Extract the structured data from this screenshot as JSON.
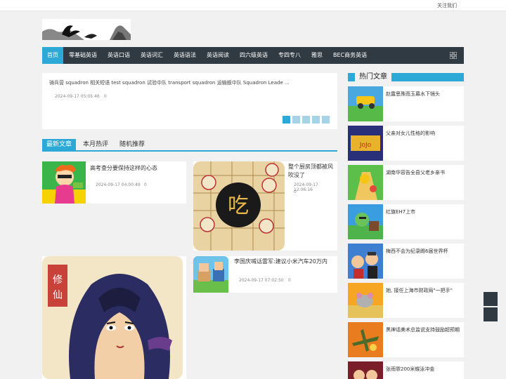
{
  "topbar": {
    "follow": "关注我们"
  },
  "nav": {
    "items": [
      "首页",
      "零基础英语",
      "英语口语",
      "英语词汇",
      "英语语法",
      "英语阅读",
      "四六级英语",
      "专四专八",
      "雅思",
      "BEC商务英语"
    ]
  },
  "slider": {
    "title": "骑兵营    squadron 相关短语    test squadron 试验中队  transport squadron 运输舰中队  Squadron Leade ...",
    "time": "2024-09-17 05:05:46",
    "views": "0"
  },
  "tabs": [
    "最新文章",
    "本月热评",
    "随机推荐"
  ],
  "articles": [
    {
      "title": "高考查分要保持这样的心态",
      "time": "2024-09-17 04:00:49",
      "views": "0"
    },
    {
      "title": "整个厨房顶都被风吹没了",
      "time": "2024-09-17 12:06:16",
      "views": "0"
    },
    {
      "title": "李国庆喊话雷军:建议小米汽车20万内",
      "time": "2024-09-17 07:02:50",
      "views": "0"
    }
  ],
  "sidebar": {
    "heading": "热门文章",
    "items": [
      "赵露思殊而玉幕水下镜头",
      "父亲对女儿性格的影响",
      "湖南华容告全县父老乡亲书",
      "红旗EH7上市",
      "梅西不会为纪录踢6届世界杯",
      "她, 接任上海市财政局\"一把手\"",
      "黑神话美术总监说支持鼓励超预期",
      "张雨霏200米蝶泳冲金"
    ]
  },
  "colors": {
    "accent": "#2da9d8",
    "nav_bg": "#2f3a42",
    "page_bg": "#f1f1f1"
  }
}
